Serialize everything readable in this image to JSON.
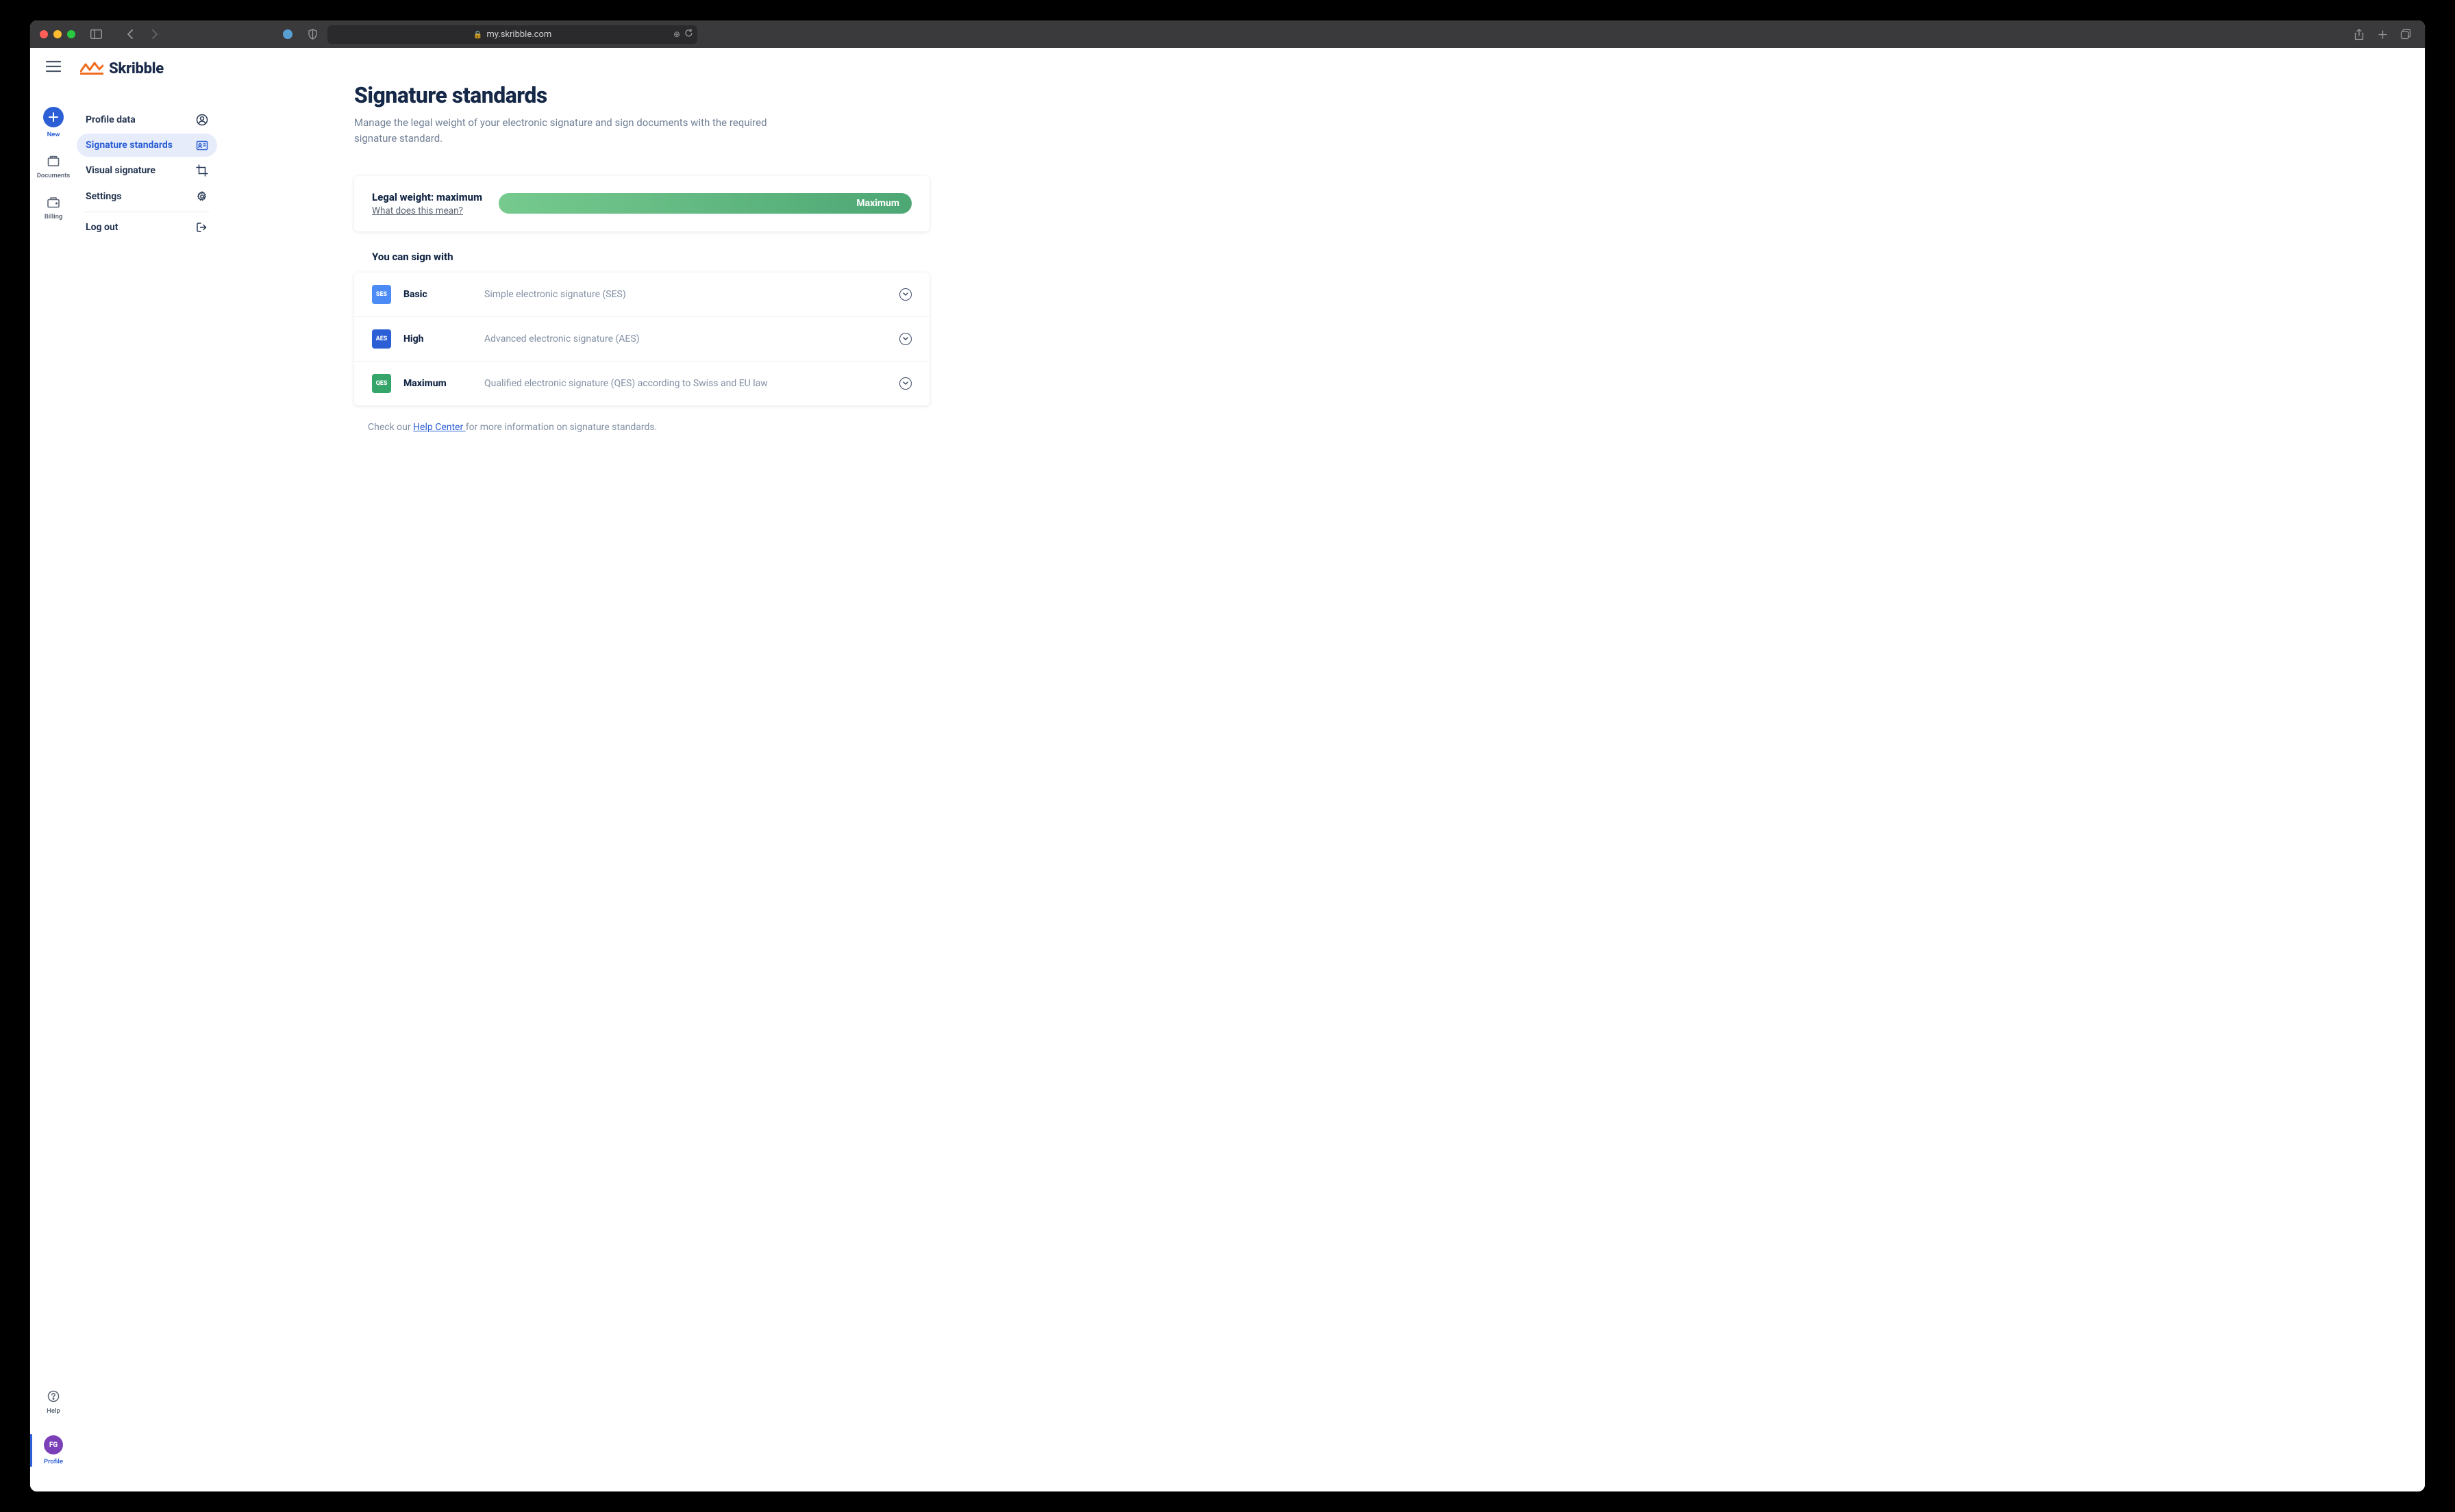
{
  "browser": {
    "url": "my.skribble.com"
  },
  "brand": "Skribble",
  "rail": {
    "new": "New",
    "documents": "Documents",
    "billing": "Billing",
    "help": "Help",
    "profile": "Profile",
    "avatar_initials": "FG"
  },
  "menu": {
    "profile_data": "Profile data",
    "signature_standards": "Signature standards",
    "visual_signature": "Visual signature",
    "settings": "Settings",
    "log_out": "Log out"
  },
  "page": {
    "title": "Signature standards",
    "subtitle": "Manage the legal weight of your electronic signature and sign documents with the required signature standard."
  },
  "legal_weight": {
    "label": "Legal weight: maximum",
    "help_text": "What does this mean?",
    "bar_label": "Maximum"
  },
  "sign_with": {
    "heading": "You can sign with",
    "rows": [
      {
        "badge": "SES",
        "badge_class": "ses",
        "name": "Basic",
        "desc": "Simple electronic signature (SES)"
      },
      {
        "badge": "AES",
        "badge_class": "aes",
        "name": "High",
        "desc": "Advanced electronic signature (AES)"
      },
      {
        "badge": "QES",
        "badge_class": "qes",
        "name": "Maximum",
        "desc": "Qualified electronic signature (QES) according to Swiss and EU law"
      }
    ]
  },
  "footer": {
    "prefix": "Check our ",
    "link": "Help Center ",
    "suffix": "for more information on signature standards."
  }
}
